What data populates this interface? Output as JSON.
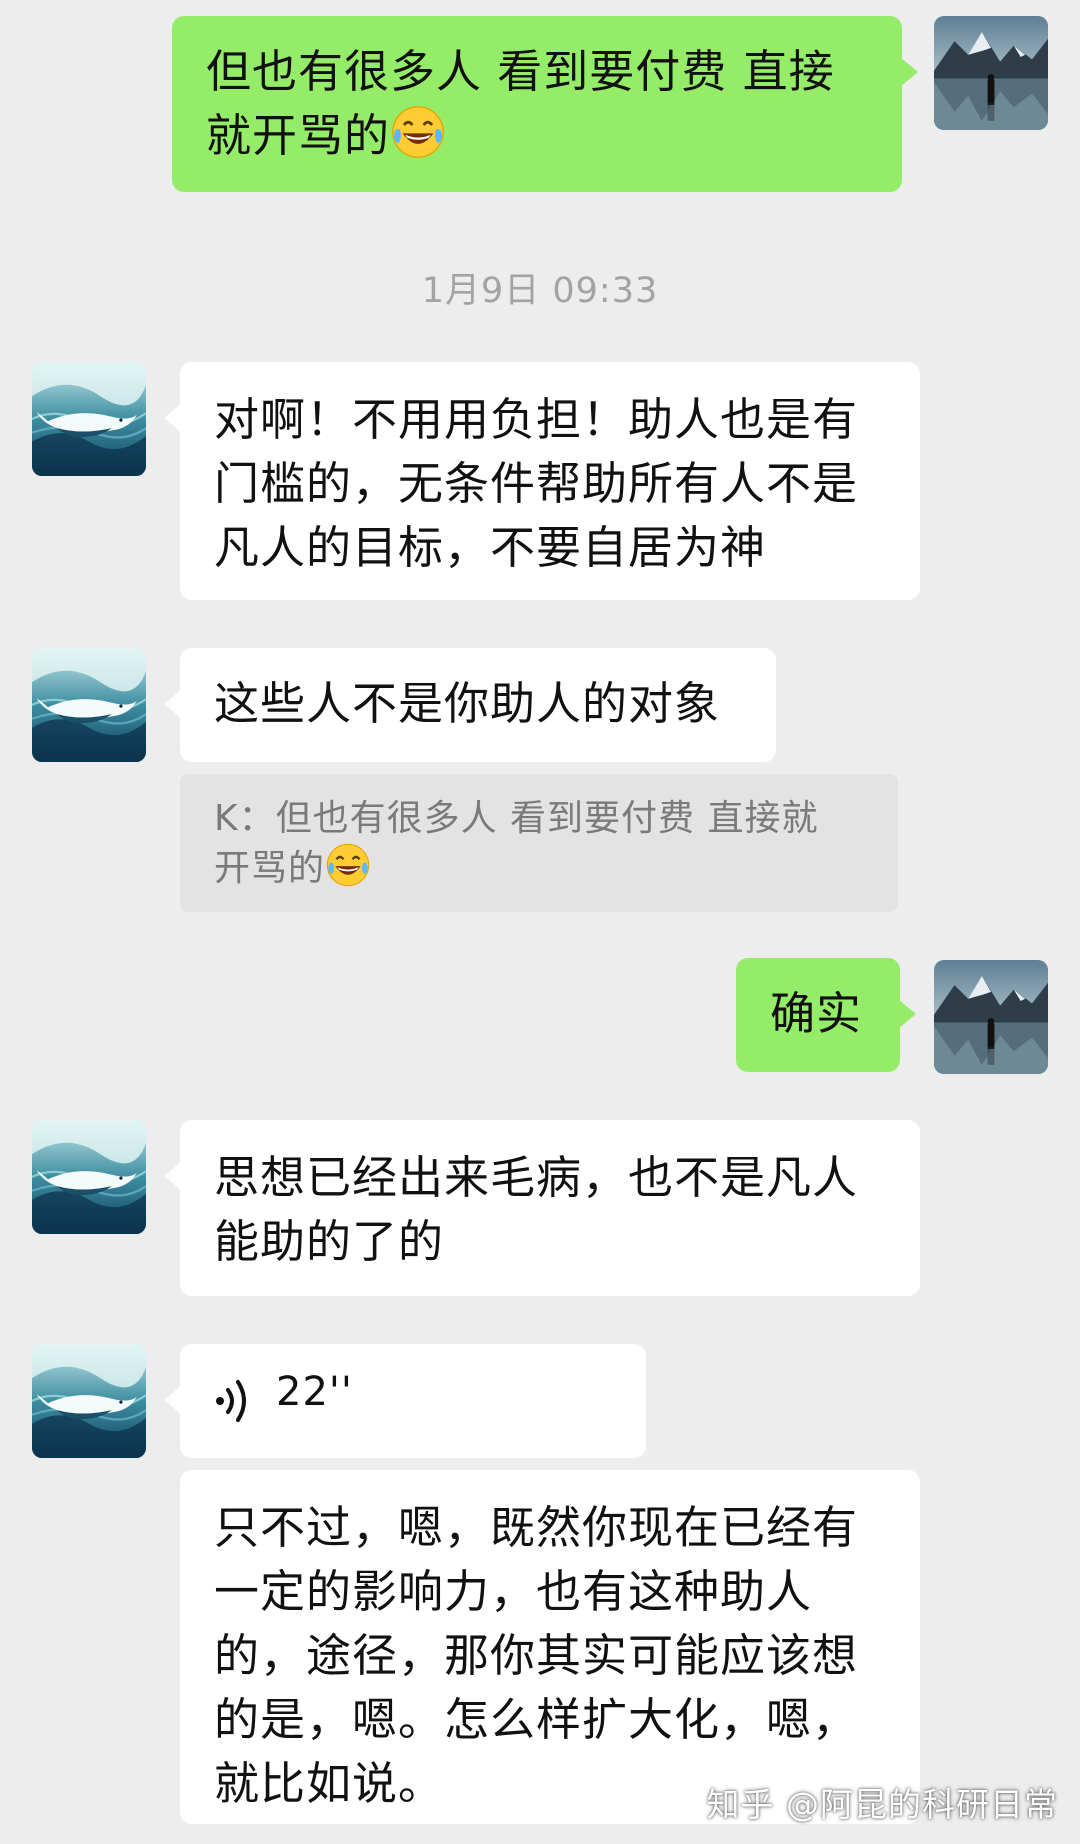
{
  "messages": {
    "m1": {
      "text": "但也有很多人 看到要付费  直接\n就开骂的"
    },
    "m2": {
      "text": "对啊！不用用负担！助人也是有\n门槛的，无条件帮助所有人不是\n凡人的目标，不要自居为神"
    },
    "m3": {
      "text": "这些人不是你助人的对象"
    },
    "m3_quote": {
      "text": "K：但也有很多人 看到要付费  直接就\n开骂的"
    },
    "m4": {
      "text": "确实"
    },
    "m5": {
      "text": "思想已经出来毛病，也不是凡人\n能助的了的"
    },
    "m6_voice": {
      "duration": "22''"
    },
    "m7": {
      "text": "只不过，嗯，既然你现在已经有\n一定的影响力，也有这种助人\n的，途径，那你其实可能应该想\n的是，嗯。怎么样扩大化，嗯，\n就比如说。"
    }
  },
  "timestamp": "1月9日 09:33",
  "watermark": "知乎 @阿昆的科研日常",
  "icons": {
    "emoji": "laughing-tears-emoji",
    "voice": "voice-wave-icon",
    "avatar_self": "lake-mountain-avatar",
    "avatar_other": "whale-wave-avatar"
  },
  "colors": {
    "background": "#ededed",
    "bubble_self": "#95ec69",
    "bubble_other": "#ffffff",
    "quote_bg": "#e3e3e3",
    "timestamp": "#a3a3a3"
  }
}
